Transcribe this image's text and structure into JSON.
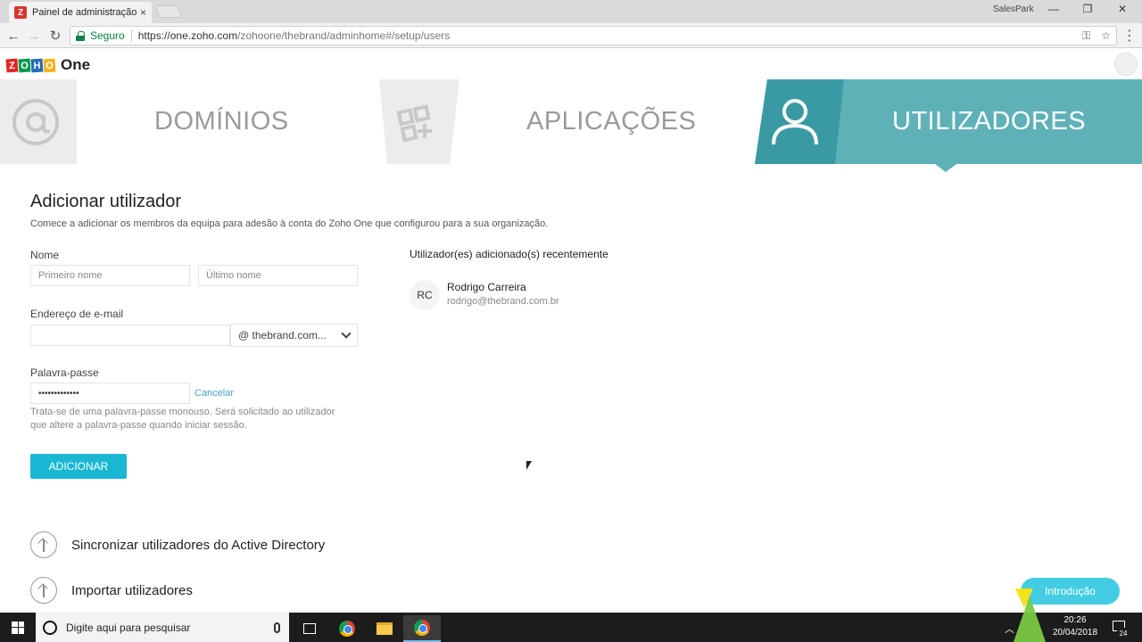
{
  "browser": {
    "tab_title": "Painel de administração",
    "tab_close": "×",
    "profile": "SalesPark",
    "secure_label": "Seguro",
    "url_domain": "https://one.zoho.com",
    "url_path": "/zohoone/thebrand/adminhome#/setup/users",
    "icons": [
      "back-icon",
      "forward-icon",
      "reload-icon",
      "lock-icon",
      "key-icon",
      "star-icon",
      "menu-icon"
    ]
  },
  "brand": {
    "letters": [
      "Z",
      "O",
      "H",
      "O"
    ],
    "letter_colors": [
      "#e42527",
      "#089949",
      "#226db4",
      "#f9b21d"
    ],
    "product": "One"
  },
  "nav": {
    "items": [
      {
        "label": "DOMÍNIOS",
        "icon": "at-sign-icon",
        "active": false
      },
      {
        "label": "APLICAÇÕES",
        "icon": "apps-grid-icon",
        "active": false
      },
      {
        "label": "UTILIZADORES",
        "icon": "user-icon",
        "active": true
      }
    ],
    "active_color": "#5fb1b8"
  },
  "form": {
    "title": "Adicionar utilizador",
    "subtitle": "Comece a adicionar os membros da equipa para adesão à conta do Zoho One que configurou para a sua organização.",
    "name_label": "Nome",
    "first_name_placeholder": "Primeiro nome",
    "last_name_placeholder": "Último nome",
    "email_label": "Endereço de e-mail",
    "email_value": "",
    "domain_value": "@ thebrand.com...",
    "password_label": "Palavra-passe",
    "password_value": "•••••••••••••",
    "cancel_label": "Cancelar",
    "password_hint": "Trata-se de uma palavra-passe monouso. Será solicitado ao utilizador que altere a palavra-passe quando iniciar sessão.",
    "add_button": "ADICIONAR",
    "button_color": "#1ab7d3"
  },
  "recent": {
    "title": "Utilizador(es) adicionado(s) recentemente",
    "users": [
      {
        "initials": "RC",
        "name": "Rodrigo Carreira",
        "email": "rodrigo@thebrand.com.br"
      }
    ]
  },
  "sections": {
    "sync_ad": "Sincronizar utilizadores do Active Directory",
    "import_users": "Importar utilizadores"
  },
  "intro_button": "Introdução",
  "taskbar": {
    "search_placeholder": "Digite aqui para pesquisar",
    "time": "20:26",
    "date": "20/04/2018",
    "notification_count": "24"
  }
}
